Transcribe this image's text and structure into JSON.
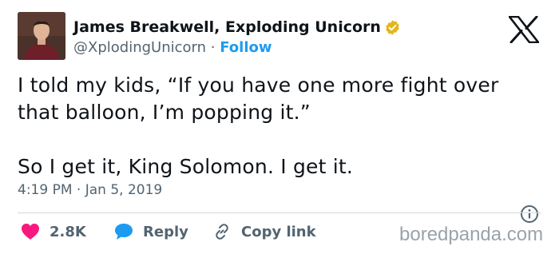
{
  "author": {
    "display_name": "James Breakwell, Exploding Unicorn",
    "handle": "@XplodingUnicorn",
    "separator": "·",
    "follow_label": "Follow",
    "verified_badge_color": "#e2b719"
  },
  "tweet": {
    "text": "I told my kids, “If you have one more fight over that balloon, I’m popping it.”\n\nSo I get it, King Solomon. I get it.",
    "timestamp": "4:19 PM · Jan 5, 2019"
  },
  "actions": {
    "like_count": "2.8K",
    "reply_label": "Reply",
    "copy_label": "Copy link"
  },
  "watermark": "boredpanda.com",
  "icons": {
    "logo": "x-logo-icon",
    "verified": "verified-badge-icon",
    "info": "info-icon",
    "like": "heart-icon",
    "reply": "speech-bubble-icon",
    "copy": "link-icon"
  },
  "colors": {
    "accent": "#1d9bf0",
    "like": "#f91880",
    "text": "#0f1419",
    "muted": "#536471"
  }
}
